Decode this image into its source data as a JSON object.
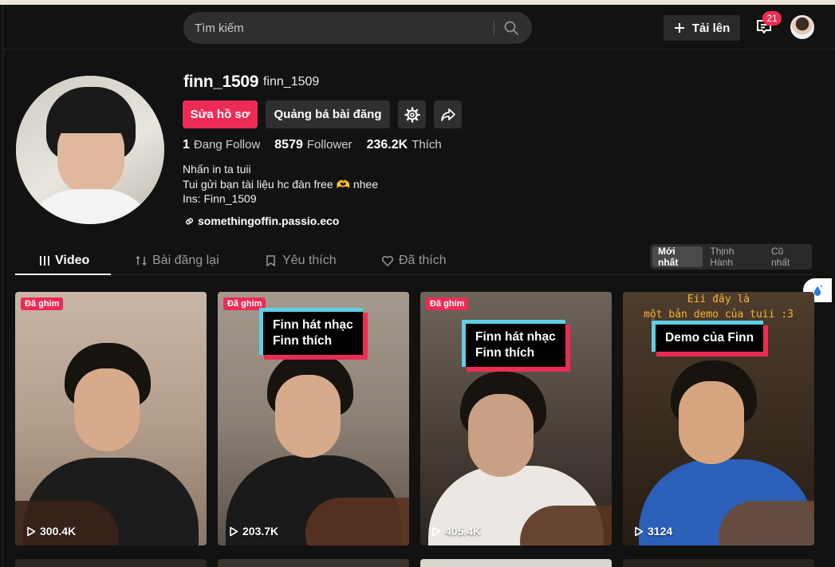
{
  "header": {
    "search_placeholder": "Tìm kiếm",
    "upload_label": "Tải lên",
    "inbox_badge": "21"
  },
  "profile": {
    "username": "finn_1509",
    "nickname": "finn_1509",
    "edit_label": "Sửa hồ sơ",
    "promote_label": "Quảng bá bài đăng",
    "stats": [
      {
        "num": "1",
        "label": "Đang Follow"
      },
      {
        "num": "8579",
        "label": "Follower"
      },
      {
        "num": "236.2K",
        "label": "Thích"
      }
    ],
    "bio": [
      "Nhấn in ta tuii",
      "Tui gửi bạn tài liệu hc đàn free 🫶 nhee",
      "Ins: Finn_1509"
    ],
    "link": "somethingoffin.passio.eco"
  },
  "tabs": [
    {
      "label": "Video",
      "icon": "grid-icon"
    },
    {
      "label": "Bài đăng lại",
      "icon": "repost-icon"
    },
    {
      "label": "Yêu thích",
      "icon": "bookmark-icon"
    },
    {
      "label": "Đã thích",
      "icon": "heart-icon"
    }
  ],
  "sort": [
    "Mới nhất",
    "Thịnh Hành",
    "Cũ nhất"
  ],
  "videos": [
    {
      "pinned": "Đã ghim",
      "views": "300.4K",
      "caption": ""
    },
    {
      "pinned": "Đã ghim",
      "views": "203.7K",
      "caption_l1": "Finn hát nhạc",
      "caption_l2": "Finn thích"
    },
    {
      "pinned": "Đã ghim",
      "views": "405.4K",
      "caption_l1": "Finn hát nhạc",
      "caption_l2": "Finn thích"
    },
    {
      "views": "3124",
      "caption_l1": "Demo của Finn",
      "top_l1": "Eii đây là",
      "top_l2": "một bản demo của tuii :3"
    }
  ],
  "colors": {
    "accent": "#ee2b54",
    "cyan": "#5dd0e6",
    "bg": "#121212",
    "yellow": "#f4b336"
  }
}
